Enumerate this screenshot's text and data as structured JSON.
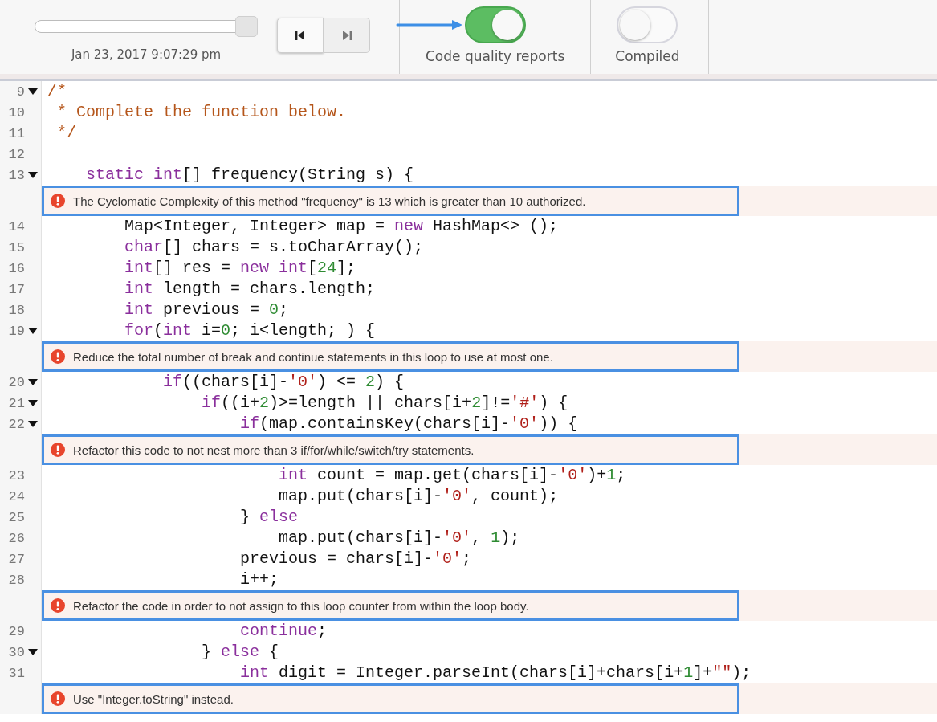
{
  "toolbar": {
    "timeline": {
      "level": 1,
      "date": "Jan 23, 2017 9:07:29 pm"
    },
    "step_buttons": [
      {
        "kind": "first",
        "disabled": false
      },
      {
        "kind": "last",
        "disabled": true
      }
    ],
    "toggles": [
      {
        "label": "Code quality reports",
        "on": true,
        "pointer_arrow": true
      },
      {
        "label": "Compiled",
        "on": false,
        "pointer_arrow": false
      }
    ]
  },
  "editor": {
    "rows": [
      {
        "kind": "code",
        "number": "9",
        "fold": true,
        "tokens": [
          {
            "kind": "comment",
            "text": "/*"
          }
        ]
      },
      {
        "kind": "code",
        "number": "10",
        "fold": false,
        "tokens": [
          {
            "kind": "comment",
            "text": " * Complete the function below."
          }
        ]
      },
      {
        "kind": "code",
        "number": "11",
        "fold": false,
        "tokens": [
          {
            "kind": "comment",
            "text": " */"
          }
        ]
      },
      {
        "kind": "code",
        "number": "12",
        "fold": false,
        "tokens": []
      },
      {
        "kind": "code",
        "number": "13",
        "fold": true,
        "tokens": [
          {
            "kind": "kw",
            "text": "    static"
          },
          {
            "kind": "kw",
            "text": " int"
          },
          {
            "kind": "plain",
            "text": "[] frequency(String s) {"
          }
        ]
      },
      {
        "kind": "issue",
        "text": "The Cyclomatic Complexity of this method \"frequency\" is 13 which is greater than 10 authorized."
      },
      {
        "kind": "code",
        "number": "14",
        "fold": false,
        "tokens": [
          {
            "kind": "plain",
            "text": "        Map<Integer, Integer> map = "
          },
          {
            "kind": "kw",
            "text": "new"
          },
          {
            "kind": "plain",
            "text": " HashMap<> ();"
          }
        ]
      },
      {
        "kind": "code",
        "number": "15",
        "fold": false,
        "tokens": [
          {
            "kind": "kw",
            "text": "        char"
          },
          {
            "kind": "plain",
            "text": "[] chars = s.toCharArray();"
          }
        ]
      },
      {
        "kind": "code",
        "number": "16",
        "fold": false,
        "tokens": [
          {
            "kind": "kw",
            "text": "        int"
          },
          {
            "kind": "plain",
            "text": "[] res = "
          },
          {
            "kind": "kw",
            "text": "new int"
          },
          {
            "kind": "plain",
            "text": "["
          },
          {
            "kind": "num",
            "text": "24"
          },
          {
            "kind": "plain",
            "text": "];"
          }
        ]
      },
      {
        "kind": "code",
        "number": "17",
        "fold": false,
        "tokens": [
          {
            "kind": "kw",
            "text": "        int"
          },
          {
            "kind": "plain",
            "text": " length = chars.length;"
          }
        ]
      },
      {
        "kind": "code",
        "number": "18",
        "fold": false,
        "tokens": [
          {
            "kind": "kw",
            "text": "        int"
          },
          {
            "kind": "plain",
            "text": " previous = "
          },
          {
            "kind": "num",
            "text": "0"
          },
          {
            "kind": "plain",
            "text": ";"
          }
        ]
      },
      {
        "kind": "code",
        "number": "19",
        "fold": true,
        "tokens": [
          {
            "kind": "kw",
            "text": "        for"
          },
          {
            "kind": "plain",
            "text": "("
          },
          {
            "kind": "kw",
            "text": "int"
          },
          {
            "kind": "plain",
            "text": " i="
          },
          {
            "kind": "num",
            "text": "0"
          },
          {
            "kind": "plain",
            "text": "; i<length; ) {"
          }
        ]
      },
      {
        "kind": "issue",
        "text": "Reduce the total number of break and continue statements in this loop to use at most one."
      },
      {
        "kind": "code",
        "number": "20",
        "fold": true,
        "tokens": [
          {
            "kind": "kw",
            "text": "            if"
          },
          {
            "kind": "plain",
            "text": "((chars[i]-"
          },
          {
            "kind": "str",
            "text": "'0'"
          },
          {
            "kind": "plain",
            "text": ") <= "
          },
          {
            "kind": "num",
            "text": "2"
          },
          {
            "kind": "plain",
            "text": ") {"
          }
        ]
      },
      {
        "kind": "code",
        "number": "21",
        "fold": true,
        "tokens": [
          {
            "kind": "kw",
            "text": "                if"
          },
          {
            "kind": "plain",
            "text": "((i+"
          },
          {
            "kind": "num",
            "text": "2"
          },
          {
            "kind": "plain",
            "text": ")>=length || chars[i+"
          },
          {
            "kind": "num",
            "text": "2"
          },
          {
            "kind": "plain",
            "text": "]!="
          },
          {
            "kind": "str",
            "text": "'#'"
          },
          {
            "kind": "plain",
            "text": ") {"
          }
        ]
      },
      {
        "kind": "code",
        "number": "22",
        "fold": true,
        "tokens": [
          {
            "kind": "kw",
            "text": "                    if"
          },
          {
            "kind": "plain",
            "text": "(map.containsKey(chars[i]-"
          },
          {
            "kind": "str",
            "text": "'0'"
          },
          {
            "kind": "plain",
            "text": ")) {"
          }
        ]
      },
      {
        "kind": "issue",
        "text": "Refactor this code to not nest more than 3 if/for/while/switch/try statements."
      },
      {
        "kind": "code",
        "number": "23",
        "fold": false,
        "tokens": [
          {
            "kind": "kw",
            "text": "                        int"
          },
          {
            "kind": "plain",
            "text": " count = map.get(chars[i]-"
          },
          {
            "kind": "str",
            "text": "'0'"
          },
          {
            "kind": "plain",
            "text": ")+"
          },
          {
            "kind": "num",
            "text": "1"
          },
          {
            "kind": "plain",
            "text": ";"
          }
        ]
      },
      {
        "kind": "code",
        "number": "24",
        "fold": false,
        "tokens": [
          {
            "kind": "plain",
            "text": "                        map.put(chars[i]-"
          },
          {
            "kind": "str",
            "text": "'0'"
          },
          {
            "kind": "plain",
            "text": ", count);"
          }
        ]
      },
      {
        "kind": "code",
        "number": "25",
        "fold": false,
        "tokens": [
          {
            "kind": "plain",
            "text": "                    } "
          },
          {
            "kind": "kw",
            "text": "else"
          }
        ]
      },
      {
        "kind": "code",
        "number": "26",
        "fold": false,
        "tokens": [
          {
            "kind": "plain",
            "text": "                        map.put(chars[i]-"
          },
          {
            "kind": "str",
            "text": "'0'"
          },
          {
            "kind": "plain",
            "text": ", "
          },
          {
            "kind": "num",
            "text": "1"
          },
          {
            "kind": "plain",
            "text": ");"
          }
        ]
      },
      {
        "kind": "code",
        "number": "27",
        "fold": false,
        "tokens": [
          {
            "kind": "plain",
            "text": "                    previous = chars[i]-"
          },
          {
            "kind": "str",
            "text": "'0'"
          },
          {
            "kind": "plain",
            "text": ";"
          }
        ]
      },
      {
        "kind": "code",
        "number": "28",
        "fold": false,
        "tokens": [
          {
            "kind": "plain",
            "text": "                    i++;"
          }
        ]
      },
      {
        "kind": "issue",
        "text": "Refactor the code in order to not assign to this loop counter from within the loop body."
      },
      {
        "kind": "code",
        "number": "29",
        "fold": false,
        "tokens": [
          {
            "kind": "kw",
            "text": "                    continue"
          },
          {
            "kind": "plain",
            "text": ";"
          }
        ]
      },
      {
        "kind": "code",
        "number": "30",
        "fold": true,
        "tokens": [
          {
            "kind": "plain",
            "text": "                } "
          },
          {
            "kind": "kw",
            "text": "else"
          },
          {
            "kind": "plain",
            "text": " {"
          }
        ]
      },
      {
        "kind": "code",
        "number": "31",
        "fold": false,
        "tokens": [
          {
            "kind": "kw",
            "text": "                    int"
          },
          {
            "kind": "plain",
            "text": " digit = Integer.parseInt(chars[i]+chars[i+"
          },
          {
            "kind": "num",
            "text": "1"
          },
          {
            "kind": "plain",
            "text": "]+"
          },
          {
            "kind": "str",
            "text": "\"\""
          },
          {
            "kind": "plain",
            "text": ");"
          }
        ]
      },
      {
        "kind": "issue",
        "text": "Use \"Integer.toString\" instead."
      }
    ]
  }
}
